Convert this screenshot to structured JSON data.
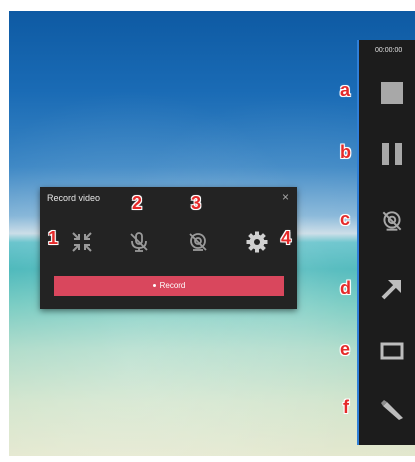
{
  "record_window": {
    "title": "Record video",
    "close_glyph": "×",
    "record_label": "Record",
    "icons": [
      "collapse-icon",
      "microphone-off-icon",
      "camera-off-icon",
      "settings-icon"
    ]
  },
  "toolbar": {
    "timer": "00:00:00",
    "buttons": [
      "stop-icon",
      "pause-icon",
      "camera-off-icon",
      "arrow-icon",
      "rectangle-icon",
      "pen-icon"
    ]
  },
  "annotations": {
    "numbers": [
      "1",
      "2",
      "3",
      "4"
    ],
    "letters": [
      "a",
      "b",
      "c",
      "d",
      "e",
      "f"
    ]
  },
  "colors": {
    "record_button": "#d9475d",
    "panel_bg": "#232323",
    "toolbar_bg": "#1c1c1c",
    "toolbar_border": "#2f7fd8",
    "annotation": "#e52a2a"
  }
}
